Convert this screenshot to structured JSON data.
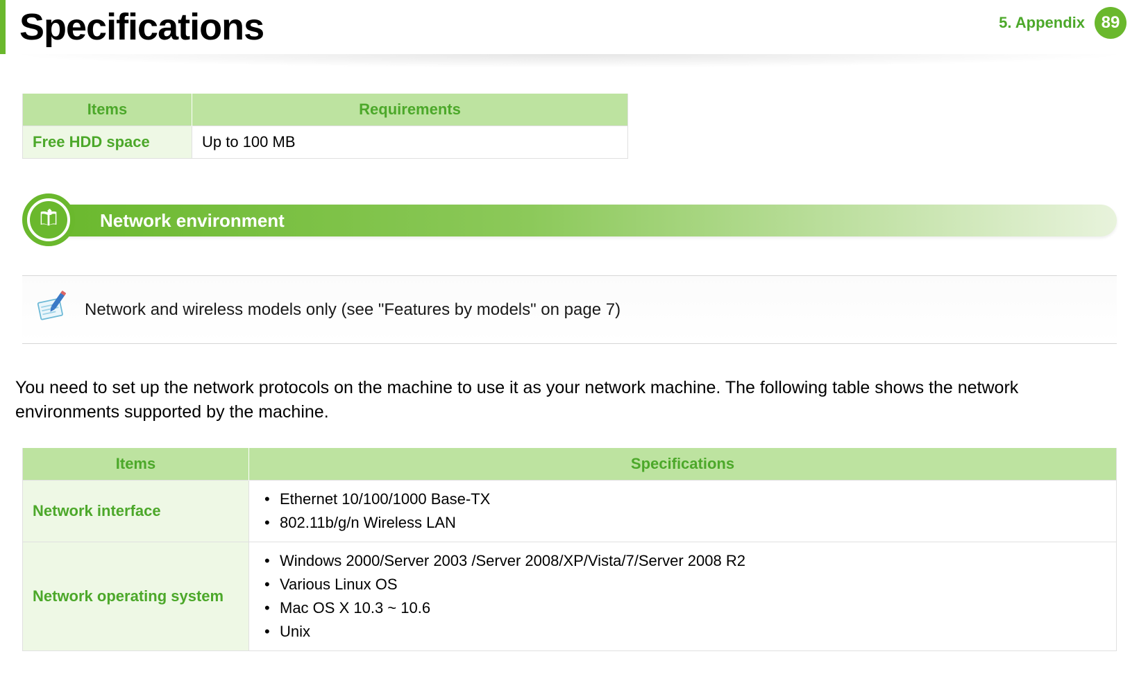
{
  "header": {
    "title": "Specifications",
    "chapter_label": "5.  Appendix",
    "page_number": "89"
  },
  "table1": {
    "col_items": "Items",
    "col_requirements": "Requirements",
    "rows": [
      {
        "item": "Free HDD space",
        "value": "Up to 100 MB"
      }
    ]
  },
  "section": {
    "title": "Network environment"
  },
  "note": {
    "text": "Network and wireless models only (see \"Features by models\" on page 7)"
  },
  "paragraph": "You need to set up the network protocols on the machine to use it as your network machine. The following table shows the network environments supported by the machine.",
  "table2": {
    "col_items": "Items",
    "col_specs": "Specifications",
    "rows": [
      {
        "item": "Network interface",
        "values": [
          "Ethernet 10/100/1000 Base-TX",
          "802.11b/g/n Wireless LAN"
        ]
      },
      {
        "item": "Network operating system",
        "values": [
          "Windows 2000/Server 2003 /Server 2008/XP/Vista/7/Server 2008 R2",
          "Various Linux OS",
          "Mac OS X 10.3 ~ 10.6",
          "Unix"
        ]
      }
    ]
  }
}
